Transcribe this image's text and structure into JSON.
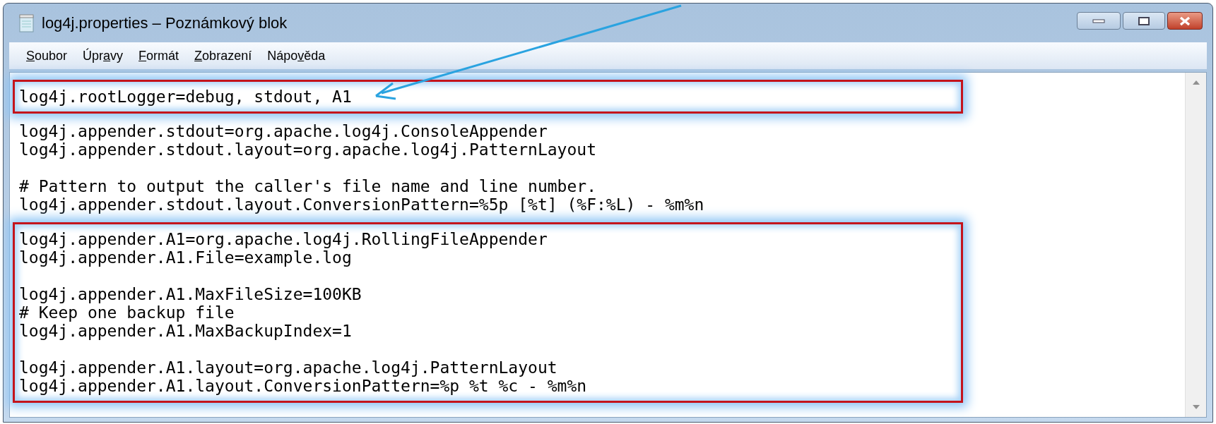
{
  "window": {
    "title": "log4j.properties – Poznámkový blok"
  },
  "menu": [
    {
      "key": "S",
      "after": "oubor"
    },
    {
      "before": "Úpr",
      "key": "a",
      "after": "vy"
    },
    {
      "key": "F",
      "after": "ormát"
    },
    {
      "key": "Z",
      "after": "obrazení"
    },
    {
      "before": "Nápo",
      "key": "v",
      "after": "ěda"
    }
  ],
  "editor": {
    "sections": [
      {
        "highlighted": true,
        "pointed": true,
        "blocks": [
          [
            "log4j.rootLogger=debug, stdout, A1"
          ]
        ]
      },
      {
        "highlighted": false,
        "pointed": false,
        "blocks": [
          [
            "log4j.appender.stdout=org.apache.log4j.ConsoleAppender",
            "log4j.appender.stdout.layout=org.apache.log4j.PatternLayout"
          ],
          [
            "# Pattern to output the caller's file name and line number.",
            "log4j.appender.stdout.layout.ConversionPattern=%5p [%t] (%F:%L) - %m%n"
          ]
        ]
      },
      {
        "highlighted": true,
        "pointed": false,
        "blocks": [
          [
            "log4j.appender.A1=org.apache.log4j.RollingFileAppender",
            "log4j.appender.A1.File=example.log"
          ],
          [
            "log4j.appender.A1.MaxFileSize=100KB",
            "# Keep one backup file",
            "log4j.appender.A1.MaxBackupIndex=1"
          ],
          [
            "log4j.appender.A1.layout=org.apache.log4j.PatternLayout",
            "log4j.appender.A1.layout.ConversionPattern=%p %t %c - %m%n"
          ]
        ]
      }
    ]
  }
}
